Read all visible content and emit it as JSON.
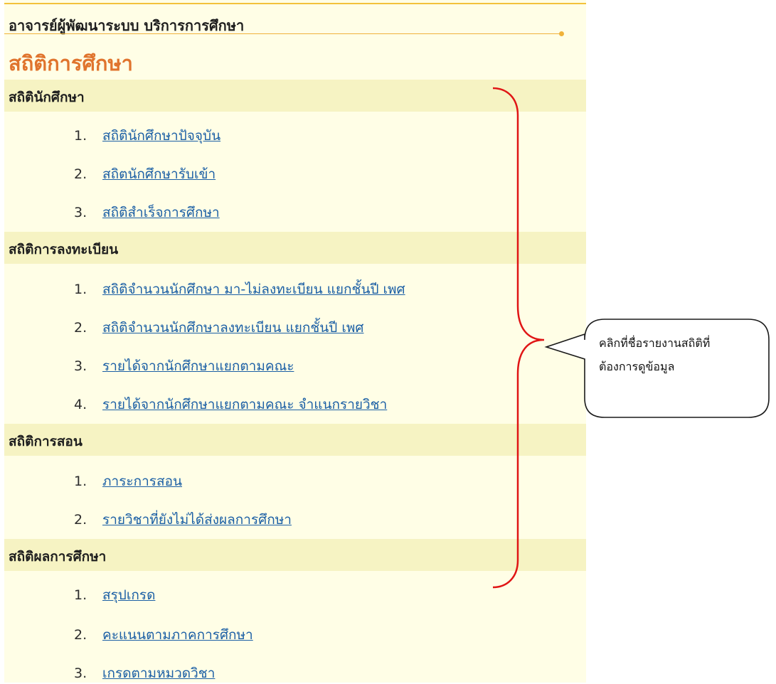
{
  "header": {
    "breadcrumb": "อาจารย์ผู้พัฒนาระบบ บริการการศึกษา",
    "title": "สถิติการศึกษา"
  },
  "sections": [
    {
      "title": "สถิตินักศึกษา",
      "items": [
        {
          "num": "1.",
          "label": "สถิตินักศึกษาปัจจุบัน"
        },
        {
          "num": "2.",
          "label": "สถิตนักศึกษารับเข้า"
        },
        {
          "num": "3.",
          "label": "สถิติสำเร็จการศึกษา"
        }
      ]
    },
    {
      "title": "สถิติการลงทะเบียน",
      "items": [
        {
          "num": "1.",
          "label": "สถิติจำนวนนักศึกษา มา-ไม่ลงทะเบียน แยกชั้นปี เพศ"
        },
        {
          "num": "2.",
          "label": "สถิติจำนวนนักศึกษาลงทะเบียน แยกชั้นปี เพศ"
        },
        {
          "num": "3.",
          "label": "รายได้จากนักศึกษาแยกตามคณะ"
        },
        {
          "num": "4.",
          "label": "รายได้จากนักศึกษาแยกตามคณะ จำแนกรายวิชา"
        }
      ]
    },
    {
      "title": "สถิติการสอน",
      "items": [
        {
          "num": "1.",
          "label": "ภาระการสอน"
        },
        {
          "num": "2.",
          "label": "รายวิชาที่ยังไม่ได้ส่งผลการศึกษา"
        }
      ]
    },
    {
      "title": "สถิติผลการศึกษา",
      "items": [
        {
          "num": "1.",
          "label": "สรุปเกรด"
        },
        {
          "num": "2.",
          "label": "คะแนนตามภาคการศึกษา"
        },
        {
          "num": "3.",
          "label": "เกรดตามหมวดวิชา"
        }
      ]
    }
  ],
  "callout": {
    "line1": "คลิกที่ชื่อรายงานสถิติที่",
    "line2": "ต้องการดูข้อมูล"
  },
  "colors": {
    "panel_bg": "#fffee6",
    "section_bg": "#f6f3c3",
    "title": "#e0742d",
    "link": "#1b5fa5",
    "brace": "#e01515"
  }
}
